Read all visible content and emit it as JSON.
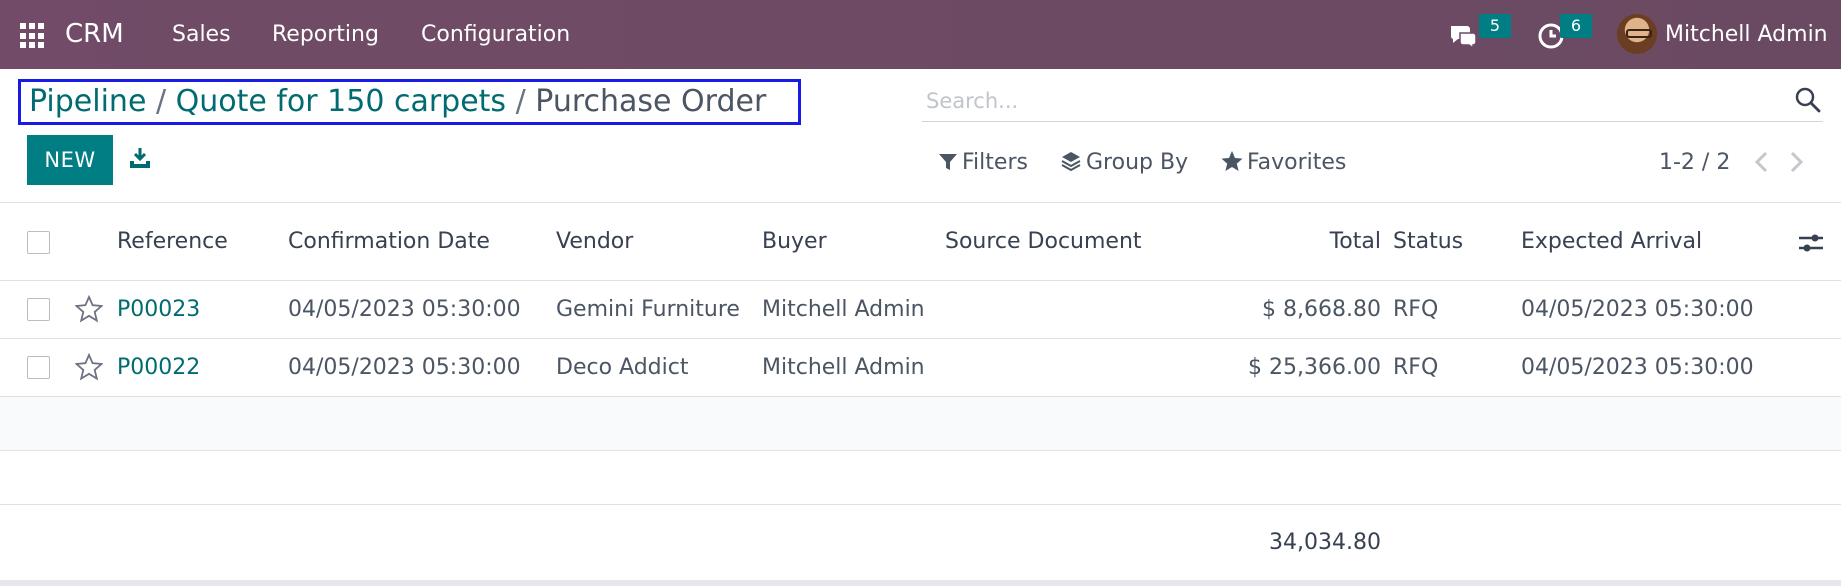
{
  "navbar": {
    "brand": "CRM",
    "menus": [
      "Sales",
      "Reporting",
      "Configuration"
    ],
    "messages_count": "5",
    "activities_count": "6",
    "user_name": "Mitchell Admin"
  },
  "breadcrumb": {
    "items": [
      "Pipeline",
      "Quote for 150 carpets"
    ],
    "separator": "/",
    "current": "Purchase Order"
  },
  "search": {
    "placeholder": "Search..."
  },
  "toolbar": {
    "new_label": "NEW"
  },
  "filters": {
    "filters_label": "Filters",
    "groupby_label": "Group By",
    "favorites_label": "Favorites"
  },
  "pager": {
    "value": "1-2 / 2"
  },
  "table": {
    "columns": [
      "Reference",
      "Confirmation Date",
      "Vendor",
      "Buyer",
      "Source Document",
      "Total",
      "Status",
      "Expected Arrival"
    ],
    "rows": [
      {
        "reference": "P00023",
        "confirmation_date": "04/05/2023 05:30:00",
        "vendor": "Gemini Furniture",
        "buyer": "Mitchell Admin",
        "source": "",
        "total": "$ 8,668.80",
        "status": "RFQ",
        "expected_arrival": "04/05/2023 05:30:00"
      },
      {
        "reference": "P00022",
        "confirmation_date": "04/05/2023 05:30:00",
        "vendor": "Deco Addict",
        "buyer": "Mitchell Admin",
        "source": "",
        "total": "$ 25,366.00",
        "status": "RFQ",
        "expected_arrival": "04/05/2023 05:30:00"
      }
    ],
    "sum_total": "34,034.80"
  },
  "colors": {
    "navbar": "#714b67",
    "primary": "#017e84",
    "link": "#016b72",
    "highlight": "#1a1ae6"
  }
}
